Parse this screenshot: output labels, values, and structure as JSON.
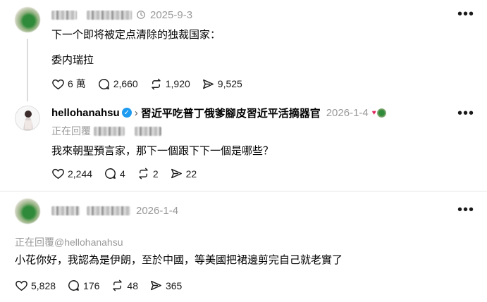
{
  "post1": {
    "time": "2025-9-3",
    "line1": "下一个即将被定点清除的独裁国家：",
    "line2": "委内瑞拉",
    "likes": "6 萬",
    "comments": "2,660",
    "reposts": "1,920",
    "shares": "9,525"
  },
  "post2": {
    "username": "hellohanahsu",
    "display_name": "習近平吃普丁俄爹腳皮習近平活摘器官",
    "time": "2026-1-4",
    "reply_prefix": "正在回覆",
    "body": "我來朝聖預言家，那下一個跟下下一個是哪些？",
    "likes": "2,244",
    "comments": "4",
    "reposts": "2",
    "shares": "22"
  },
  "post3": {
    "time": "2026-1-4",
    "reply_to": "正在回覆@hellohanahsu",
    "body": "小花你好，我認為是伊朗，至於中國，等美國把裙邊剪完自己就老實了",
    "likes": "5,828",
    "comments": "176",
    "reposts": "48",
    "shares": "365"
  },
  "more_label": "•••",
  "colors": {
    "verified": "#1d9bf0",
    "muted": "#999999",
    "heart_badge": "#e0245e"
  }
}
